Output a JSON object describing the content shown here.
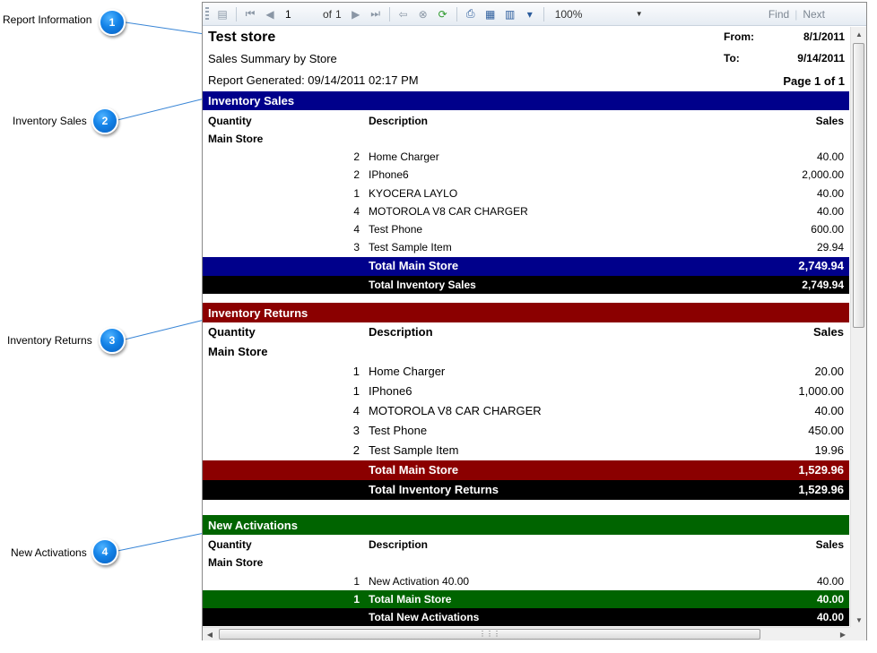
{
  "callouts": [
    {
      "number": "1",
      "label": "Report Information"
    },
    {
      "number": "2",
      "label": "Inventory Sales"
    },
    {
      "number": "3",
      "label": "Inventory Returns"
    },
    {
      "number": "4",
      "label": "New Activations"
    }
  ],
  "toolbar": {
    "page_value": "1",
    "of_label": "of",
    "total_pages": "1",
    "zoom": "100%",
    "find_label": "Find",
    "next_label": "Next"
  },
  "report": {
    "store_name": "Test store",
    "subtitle": "Sales Summary by Store",
    "generated": "Report Generated: 09/14/2011 02:17 PM",
    "from_label": "From:",
    "from_value": "8/1/2011",
    "to_label": "To:",
    "to_value": "9/14/2011",
    "page_label": "Page 1 of 1"
  },
  "columns": {
    "quantity": "Quantity",
    "description": "Description",
    "sales": "Sales"
  },
  "sections": {
    "sales": {
      "title": "Inventory Sales",
      "color": "#00008b",
      "store": "Main Store",
      "items": [
        {
          "qty": "2",
          "desc": "Home Charger",
          "amt": "40.00"
        },
        {
          "qty": "2",
          "desc": "IPhone6",
          "amt": "2,000.00"
        },
        {
          "qty": "1",
          "desc": "KYOCERA LAYLO",
          "amt": "40.00"
        },
        {
          "qty": "4",
          "desc": "MOTOROLA V8 CAR CHARGER",
          "amt": "40.00"
        },
        {
          "qty": "4",
          "desc": "Test Phone",
          "amt": "600.00"
        },
        {
          "qty": "3",
          "desc": "Test Sample Item",
          "amt": "29.94"
        }
      ],
      "store_total_label": "Total Main Store",
      "store_total": "2,749.94",
      "grand_total_label": "Total Inventory Sales",
      "grand_total": "2,749.94"
    },
    "returns": {
      "title": "Inventory Returns",
      "color": "#8b0000",
      "store": "Main Store",
      "items": [
        {
          "qty": "1",
          "desc": "Home Charger",
          "amt": "20.00"
        },
        {
          "qty": "1",
          "desc": "IPhone6",
          "amt": "1,000.00"
        },
        {
          "qty": "4",
          "desc": "MOTOROLA V8 CAR CHARGER",
          "amt": "40.00"
        },
        {
          "qty": "3",
          "desc": "Test Phone",
          "amt": "450.00"
        },
        {
          "qty": "2",
          "desc": "Test Sample Item",
          "amt": "19.96"
        }
      ],
      "store_total_label": "Total Main Store",
      "store_total": "1,529.96",
      "grand_total_label": "Total Inventory Returns",
      "grand_total": "1,529.96"
    },
    "activations": {
      "title": "New Activations",
      "color": "#006400",
      "store": "Main Store",
      "items": [
        {
          "qty": "1",
          "desc": "New Activation 40.00",
          "amt": "40.00"
        }
      ],
      "store_total_qty": "1",
      "store_total_label": "Total Main Store",
      "store_total": "40.00",
      "grand_total_label": "Total New  Activations",
      "grand_total": "40.00"
    }
  }
}
